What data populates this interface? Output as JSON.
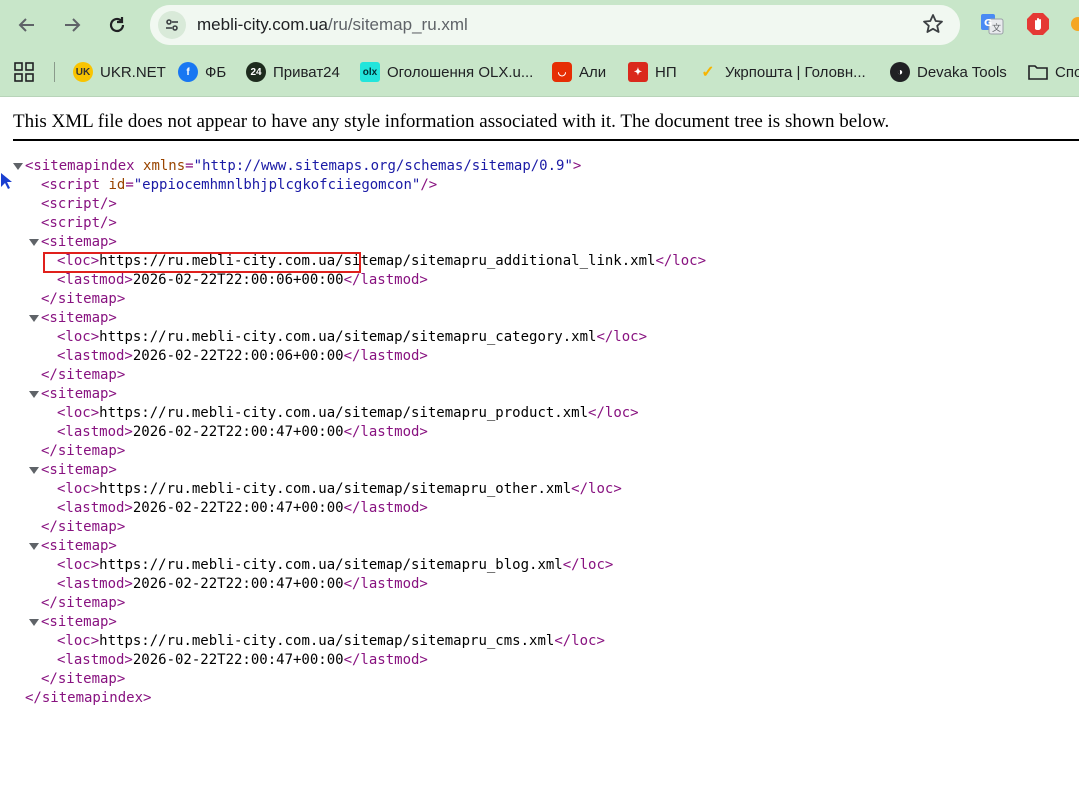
{
  "browser": {
    "url_host": "mebli-city.com.ua",
    "url_path": "/ru/sitemap_ru.xml",
    "icons": {
      "back": "back-arrow-icon",
      "forward": "forward-arrow-icon",
      "reload": "reload-icon",
      "site_info": "site-info-icon",
      "bookmark_star": "star-icon",
      "translate": "translate-extension-icon",
      "adblock": "adblock-extension-icon"
    }
  },
  "bookmarks": [
    {
      "label": "",
      "icon": "apps-grid-icon"
    },
    {
      "label": "UKR.NET",
      "icon": "ukrnet-icon"
    },
    {
      "label": "ФБ",
      "icon": "facebook-icon"
    },
    {
      "label": "Приват24",
      "icon": "privat24-icon"
    },
    {
      "label": "Оголошення OLX.u...",
      "icon": "olx-icon"
    },
    {
      "label": "Али",
      "icon": "aliexpress-icon"
    },
    {
      "label": "НП",
      "icon": "novaposhta-icon"
    },
    {
      "label": "Укрпошта | Головн...",
      "icon": "ukrposhta-icon"
    },
    {
      "label": "Devaka Tools",
      "icon": "devaka-icon"
    },
    {
      "label": "Спо",
      "icon": "folder-icon"
    }
  ],
  "notice": "This XML file does not appear to have any style information associated with it. The document tree is shown below.",
  "xml": {
    "root_open": "<sitemapindex",
    "root_attr_name": "xmlns",
    "root_attr_value": "\"http://www.sitemaps.org/schemas/sitemap/0.9\"",
    "root_open_end": ">",
    "script_open": "<script",
    "script_attr_name": "id",
    "script_attr_value": "\"eppiocemhmnlbhjplcgkofciiegomcon\"",
    "script_self_close": "/>",
    "script_empty": "<script/>",
    "sitemap_open": "<sitemap>",
    "sitemap_close": "</sitemap>",
    "loc_open": "<loc>",
    "loc_close": "</loc>",
    "lastmod_open": "<lastmod>",
    "lastmod_close": "</lastmod>",
    "root_close": "</sitemapindex>",
    "sitemaps": [
      {
        "loc": "https://ru.mebli-city.com.ua/sitemap/sitemapru_additional_link.xml",
        "lastmod": "2026-02-22T22:00:06+00:00"
      },
      {
        "loc": "https://ru.mebli-city.com.ua/sitemap/sitemapru_category.xml",
        "lastmod": "2026-02-22T22:00:06+00:00"
      },
      {
        "loc": "https://ru.mebli-city.com.ua/sitemap/sitemapru_product.xml",
        "lastmod": "2026-02-22T22:00:47+00:00"
      },
      {
        "loc": "https://ru.mebli-city.com.ua/sitemap/sitemapru_other.xml",
        "lastmod": "2026-02-22T22:00:47+00:00"
      },
      {
        "loc": "https://ru.mebli-city.com.ua/sitemap/sitemapru_blog.xml",
        "lastmod": "2026-02-22T22:00:47+00:00"
      },
      {
        "loc": "https://ru.mebli-city.com.ua/sitemap/sitemapru_cms.xml",
        "lastmod": "2026-02-22T22:00:47+00:00"
      }
    ]
  },
  "colors": {
    "toolbar_bg": "#c8e6c9",
    "tag": "#881280",
    "attr": "#994500",
    "value": "#1a1aa6",
    "highlight_border": "#e0201c"
  }
}
